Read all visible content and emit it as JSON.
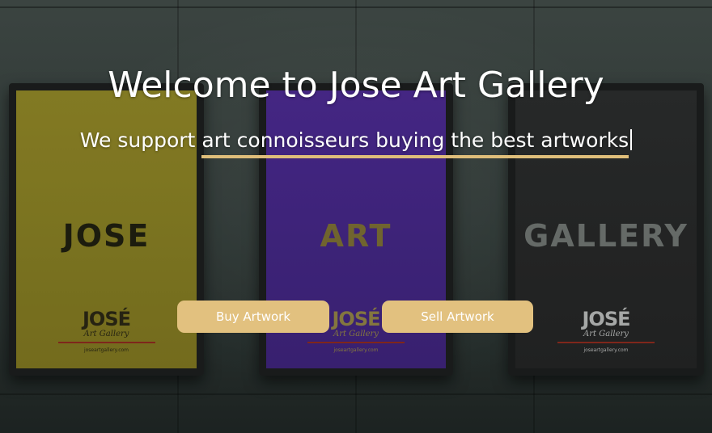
{
  "hero": {
    "title": "Welcome to Jose Art Gallery",
    "tagline_prefix": "We support ",
    "tagline_typed": "art connoisseurs buying the best artworks",
    "accent_color": "#dfbe7a"
  },
  "posters": [
    {
      "word": "JOSE",
      "logo": "JOSÉ",
      "logo_sub": "Art Gallery",
      "url": "joseartgallery.com",
      "color": "#8e8526"
    },
    {
      "word": "ART",
      "logo": "JOSÉ",
      "logo_sub": "Art Gallery",
      "url": "joseartgallery.com",
      "color": "#4a2a8f"
    },
    {
      "word": "GALLERY",
      "logo": "JOSÉ",
      "logo_sub": "Art Gallery",
      "url": "joseartgallery.com",
      "color": "#2b2d2d"
    }
  ],
  "actions": {
    "buy_label": "Buy Artwork",
    "sell_label": "Sell Artwork",
    "button_color": "#e2c17f"
  }
}
